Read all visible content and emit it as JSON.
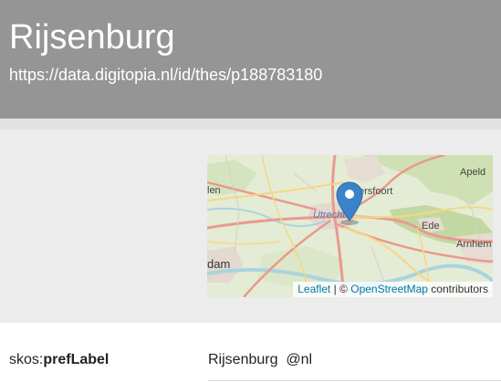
{
  "header": {
    "title": "Rijsenburg",
    "uri": "https://data.digitopia.nl/id/thes/p188783180"
  },
  "map": {
    "place_labels": [
      "Apeld",
      "len",
      "ersfoort",
      "Utrecht",
      "Ede",
      "Arnhem",
      "dam"
    ],
    "attribution": {
      "leaflet_link": "Leaflet",
      "separator": "| ©",
      "osm_link": "OpenStreetMap",
      "suffix": "contributors"
    },
    "marker_icon": "map-marker-icon",
    "colors": {
      "marker": "#3a83c8",
      "link": "#0078a8"
    }
  },
  "properties": [
    {
      "prefix": "skos:",
      "name": "prefLabel",
      "value": "Rijsenburg",
      "lang": "@nl"
    }
  ]
}
